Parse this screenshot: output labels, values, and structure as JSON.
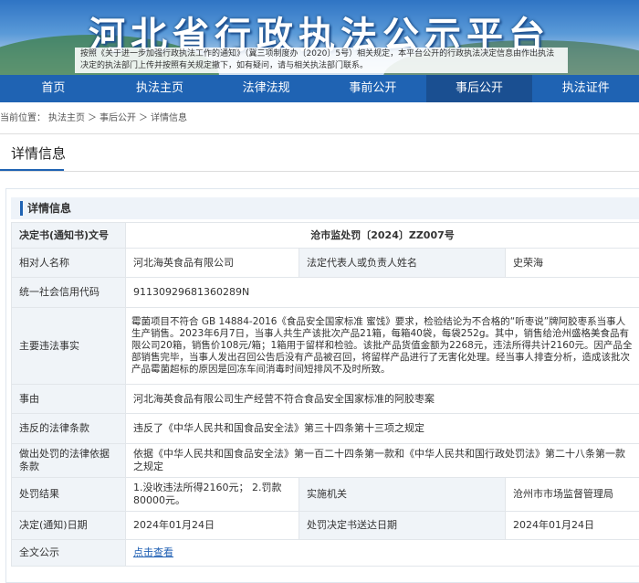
{
  "banner": {
    "title": "河北省行政执法公示平台",
    "notice": "按照《关于进一步加强行政执法工作的通知》（冀三项制度办〔2020〕5号）相关规定，本平台公开的行政执法决定信息由作出执法决定的执法部门上传并按照有关规定撤下，如有疑问，请与相关执法部门联系。"
  },
  "nav": [
    "首页",
    "执法主页",
    "法律法规",
    "事前公开",
    "事后公开",
    "执法证件"
  ],
  "breadcrumb": [
    "当前位置：",
    "执法主页",
    "＞",
    "事后公开",
    "＞",
    "详情信息"
  ],
  "page_title": "详情信息",
  "section_title": "详情信息",
  "rows": {
    "decision_no_label": "决定书(通知书)文号",
    "decision_no": "沧市监处罚〔2024〕ZZ007号",
    "party_label": "相对人名称",
    "party": "河北海英食品有限公司",
    "legal_rep_label": "法定代表人或负责人姓名",
    "legal_rep": "史荣海",
    "credit_code_label": "统一社会信用代码",
    "credit_code": "91130929681360289N",
    "facts_label": "主要违法事实",
    "facts": "霉菌项目不符合 GB 14884-2016《食品安全国家标准 蜜饯》要求，检验结论为不合格的“听枣说”牌阿胶枣系当事人生产销售。2023年6月7日，当事人共生产该批次产品21箱，每箱40袋，每袋252g。其中，销售给沧州盛格美食品有限公司20箱，销售价108元/箱；1箱用于留样和检验。该批产品货值金额为2268元，违法所得共计2160元。因产品全部销售完毕，当事人发出召回公告后没有产品被召回，将留样产品进行了无害化处理。经当事人排查分析，造成该批次产品霉菌超标的原因是回冻车间消毒时间短排风不及时所致。",
    "cause_label": "事由",
    "cause": "河北海英食品有限公司生产经营不符合食品安全国家标准的阿胶枣案",
    "violated_label": "违反的法律条款",
    "violated": "违反了《中华人民共和国食品安全法》第三十四条第十三项之规定",
    "basis_label": "做出处罚的法律依据条款",
    "basis": "依据《中华人民共和国食品安全法》第一百二十四条第一款和《中华人民共和国行政处罚法》第二十八条第一款之规定",
    "result_label": "处罚结果",
    "result": "1.没收违法所得2160元；  2.罚款80000元。",
    "agency_label": "实施机关",
    "agency": "沧州市市场监督管理局",
    "decision_date_label": "决定(通知)日期",
    "decision_date": "2024年01月24日",
    "delivery_date_label": "处罚决定书送达日期",
    "delivery_date": "2024年01月24日",
    "full_text_label": "全文公示",
    "full_text_link": "点击查看"
  }
}
